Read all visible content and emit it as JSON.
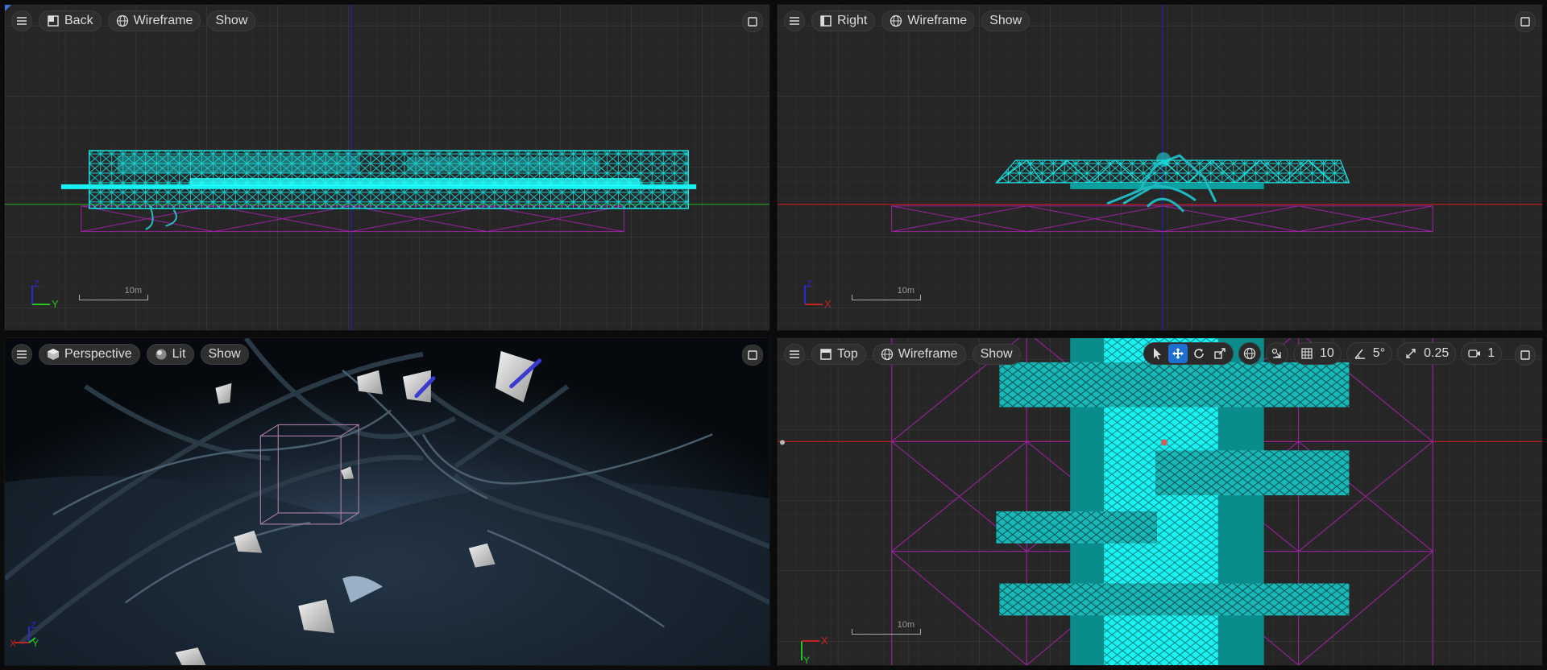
{
  "viewports": {
    "back": {
      "view_label": "Back",
      "mode_label": "Wireframe",
      "show_label": "Show",
      "scale_label": "10m",
      "axis_v": "Z",
      "axis_h": "Y"
    },
    "right": {
      "view_label": "Right",
      "mode_label": "Wireframe",
      "show_label": "Show",
      "scale_label": "10m",
      "axis_v": "Z",
      "axis_h": "X"
    },
    "perspective": {
      "view_label": "Perspective",
      "mode_label": "Lit",
      "show_label": "Show",
      "axis_labels": [
        "X",
        "Y",
        "Z"
      ]
    },
    "top": {
      "view_label": "Top",
      "mode_label": "Wireframe",
      "show_label": "Show",
      "scale_label": "10m",
      "axis_v": "Y",
      "axis_h": "X"
    }
  },
  "snap_toolbar": {
    "grid_snap_value": "10",
    "rotation_snap_value": "5°",
    "scale_snap_value": "0.25",
    "camera_speed_value": "1",
    "active_tool": "translate"
  },
  "colors": {
    "wire_cyan": "#19e5e5",
    "wire_teal": "#0a8c8c",
    "volume_magenta": "#b024b4",
    "grid_line": "#353535",
    "grid_major": "#454545",
    "axis_red": "#b81d1d",
    "axis_green": "#1db81d",
    "axis_blue": "#2a2ac8",
    "accent_blue": "#1f6fd1"
  }
}
